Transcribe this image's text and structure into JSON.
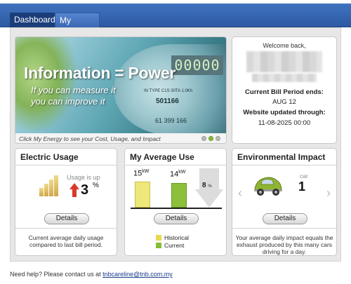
{
  "nav": {
    "tabs": [
      {
        "label": "Dashboard",
        "active": true
      },
      {
        "label": "My Energy",
        "active": false
      }
    ]
  },
  "banner": {
    "title": "Information = Power",
    "subtitle_line1": "If you can measure it",
    "subtitle_line2": "you can improve it",
    "caption": "Click My Energy to see your Cost, Usage, and Impact",
    "meter_reading": "00000",
    "meter_text": "IN TYPE C1S 30TA 1.0Kh",
    "meter_serial": "501166",
    "meter_second": "61 399 166",
    "slides": 3,
    "active_slide": 1
  },
  "welcome": {
    "greeting": "Welcome back,",
    "bill_period_label": "Current Bill Period ends:",
    "bill_period_date": "AUG 12",
    "updated_label": "Website updated through:",
    "updated_date": "11-08-2025 00:00"
  },
  "electric_usage": {
    "title": "Electric Usage",
    "status_label": "Usage is up",
    "value": "3",
    "unit": "%",
    "details_label": "Details",
    "description": "Current average daily usage compared to last bill period."
  },
  "average_use": {
    "title": "My Average Use",
    "historical_value": "15",
    "current_value": "14",
    "unit": "kW",
    "change_value": "8",
    "change_unit": "%",
    "historical_level": 0.85,
    "current_level": 0.79,
    "details_label": "Details",
    "legend_historical": "Historical",
    "legend_current": "Current"
  },
  "environmental_impact": {
    "title": "Environmental Impact",
    "item_label": "car",
    "value": "1",
    "details_label": "Details",
    "description": "Your average daily impact equals the exhaust produced by this many cars driving for a day."
  },
  "footer": {
    "text": "Need help? Please contact us at ",
    "email": "tnbcareline@tnb.com.my"
  },
  "colors": {
    "nav": "#3462ad",
    "historical": "#e7d94f",
    "current": "#86bd37",
    "arrow_up": "#d93a2b"
  }
}
